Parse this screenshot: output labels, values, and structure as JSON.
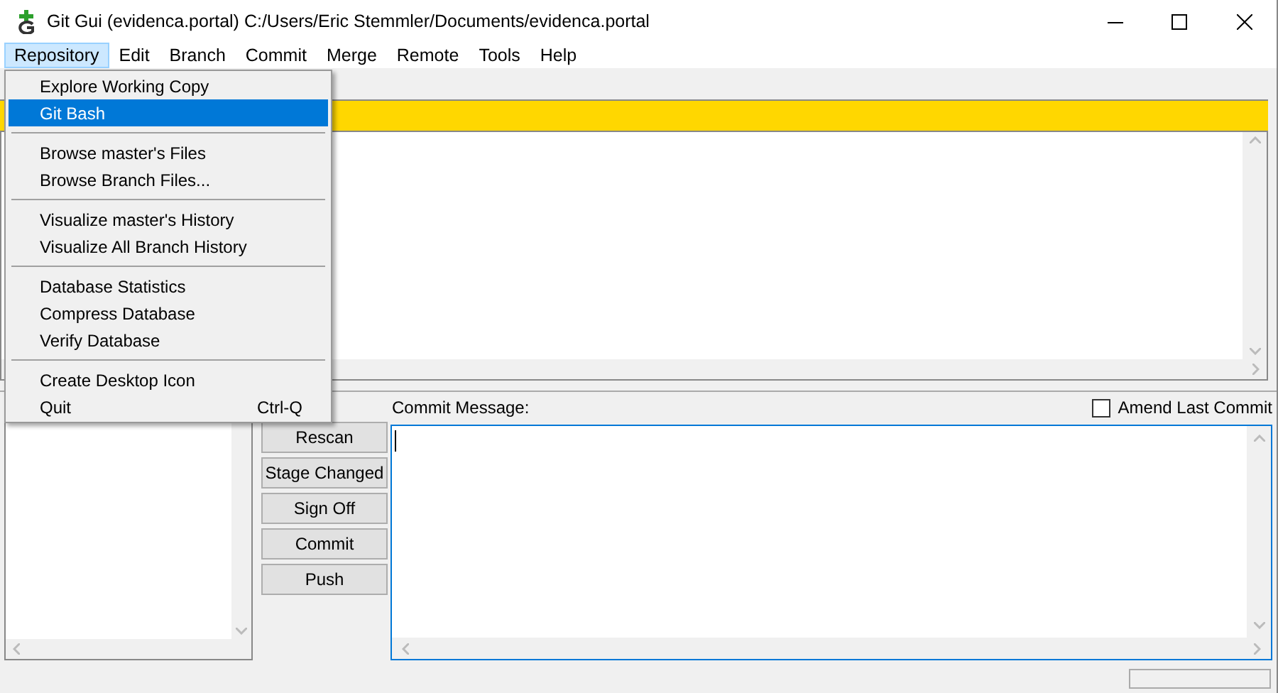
{
  "window": {
    "title": "Git Gui (evidenca.portal) C:/Users/Eric Stemmler/Documents/evidenca.portal"
  },
  "menu_bar": [
    {
      "label": "Repository",
      "selected": true
    },
    {
      "label": "Edit",
      "selected": false
    },
    {
      "label": "Branch",
      "selected": false
    },
    {
      "label": "Commit",
      "selected": false
    },
    {
      "label": "Merge",
      "selected": false
    },
    {
      "label": "Remote",
      "selected": false
    },
    {
      "label": "Tools",
      "selected": false
    },
    {
      "label": "Help",
      "selected": false
    }
  ],
  "open_menu": {
    "groups": [
      [
        {
          "label": "Explore Working Copy",
          "selected": false
        },
        {
          "label": "Git Bash",
          "selected": true
        }
      ],
      [
        {
          "label": "Browse master's Files",
          "selected": false
        },
        {
          "label": "Browse Branch Files...",
          "selected": false
        }
      ],
      [
        {
          "label": "Visualize master's History",
          "selected": false
        },
        {
          "label": "Visualize All Branch History",
          "selected": false
        }
      ],
      [
        {
          "label": "Database Statistics",
          "selected": false
        },
        {
          "label": "Compress Database",
          "selected": false
        },
        {
          "label": "Verify Database",
          "selected": false
        }
      ],
      [
        {
          "label": "Create Desktop Icon",
          "selected": false
        },
        {
          "label": "Quit",
          "shortcut": "Ctrl-Q",
          "selected": false
        }
      ]
    ]
  },
  "action_buttons": [
    "Rescan",
    "Stage Changed",
    "Sign Off",
    "Commit",
    "Push"
  ],
  "commit": {
    "label": "Commit Message:",
    "amend": {
      "label": "Amend Last Commit",
      "checked": false
    }
  }
}
